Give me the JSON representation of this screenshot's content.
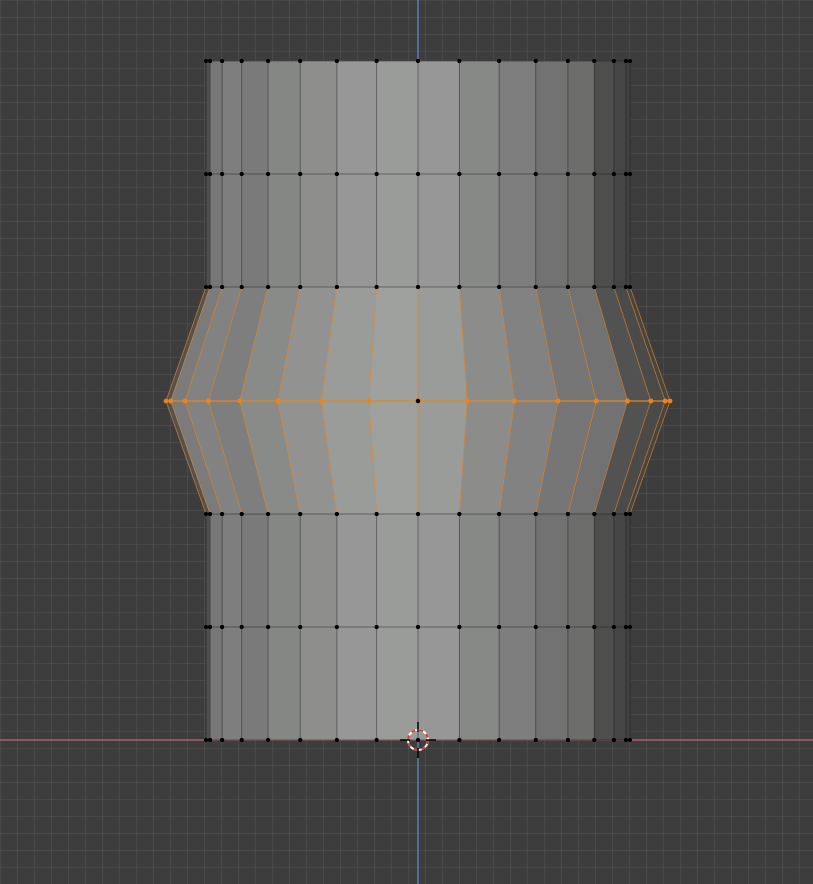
{
  "viewport": {
    "view": "front-orthographic",
    "mode": "edit-mode",
    "select_mode": "vertex"
  },
  "colors": {
    "background": "#3d3d3d",
    "grid_line": "#474747",
    "x_axis": "#c46674",
    "z_axis": "#5a8fd0",
    "selection": "#e8851e",
    "vertex": "#000000",
    "cursor_ring": "#d0402a",
    "face_light": "#a4a6a4",
    "face_dark": "#3e3d3d"
  },
  "mesh": {
    "object_type": "cylinder",
    "selected_edge_loop": "middle-ring",
    "face_column_shades": [
      0.16,
      0.55,
      0.62,
      0.58,
      0.7,
      0.78,
      0.86,
      0.9,
      0.86,
      0.72,
      0.62,
      0.5,
      0.46,
      0.16,
      0.08,
      0.04
    ]
  },
  "icons": {
    "cursor": "3d-cursor-icon",
    "origin": "object-origin-icon"
  }
}
